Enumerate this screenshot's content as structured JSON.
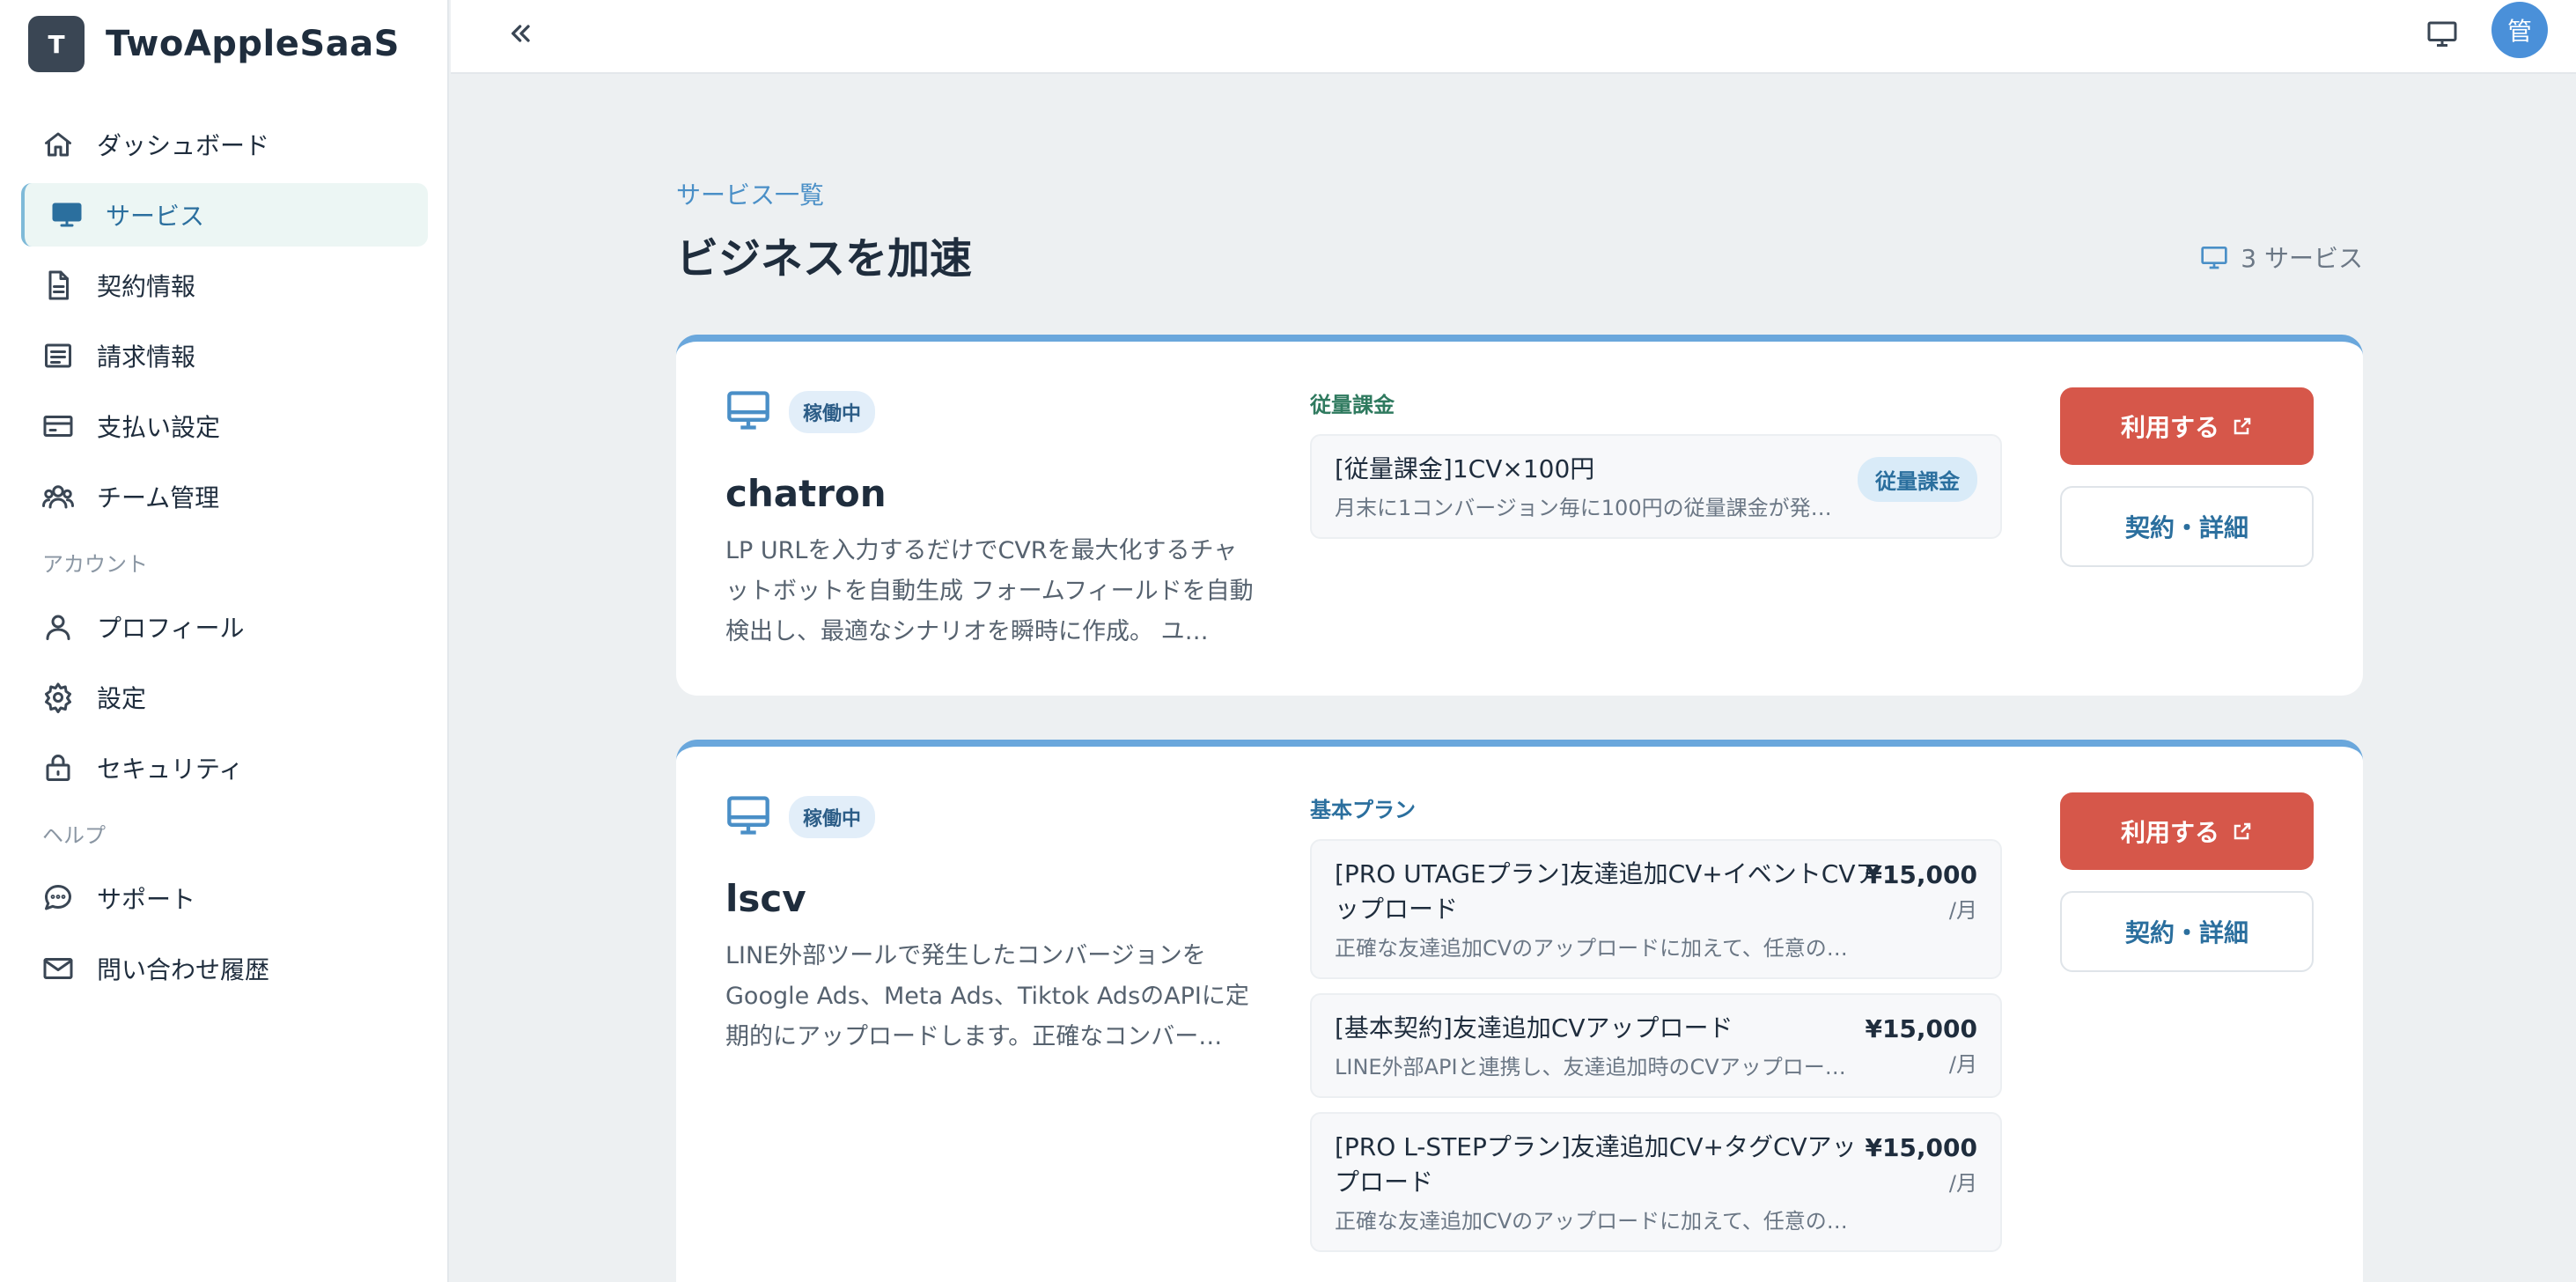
{
  "brand": {
    "logo_letter": "T",
    "name": "TwoAppleSaaS"
  },
  "sidebar": {
    "items": [
      {
        "label": "ダッシュボード",
        "icon": "home-icon"
      },
      {
        "label": "サービス",
        "icon": "monitor-icon",
        "active": true
      },
      {
        "label": "契約情報",
        "icon": "document-icon"
      },
      {
        "label": "請求情報",
        "icon": "invoice-icon"
      },
      {
        "label": "支払い設定",
        "icon": "credit-card-icon"
      },
      {
        "label": "チーム管理",
        "icon": "team-icon"
      }
    ],
    "account_section": "アカウント",
    "account_items": [
      {
        "label": "プロフィール",
        "icon": "user-icon"
      },
      {
        "label": "設定",
        "icon": "gear-icon"
      },
      {
        "label": "セキュリティ",
        "icon": "lock-icon"
      }
    ],
    "help_section": "ヘルプ",
    "help_items": [
      {
        "label": "サポート",
        "icon": "chat-icon"
      },
      {
        "label": "問い合わせ履歴",
        "icon": "mail-icon"
      }
    ]
  },
  "topbar": {
    "avatar_initial": "管"
  },
  "main": {
    "breadcrumb": "サービス一覧",
    "title": "ビジネスを加速",
    "service_count": "3 サービス"
  },
  "services": [
    {
      "status": "稼働中",
      "name": "chatron",
      "description": "LP URLを入力するだけでCVRを最大化するチャットボットを自動生成 フォームフィールドを自動検出し、最適なシナリオを瞬時に作成。 ユ…",
      "plan_heading": "従量課金",
      "plans": [
        {
          "title": "[従量課金]1CV×100円",
          "sub": "月末に1コンバージョン毎に100円の従量課金が発…",
          "tag": "従量課金"
        }
      ],
      "use_label": "利用する",
      "detail_label": "契約・詳細"
    },
    {
      "status": "稼働中",
      "name": "lscv",
      "description": "LINE外部ツールで発生したコンバージョンをGoogle Ads、Meta Ads、Tiktok AdsのAPIに定期的にアップロードします。正確なコンバー…",
      "plan_heading": "基本プラン",
      "plans": [
        {
          "title": "[PRO UTAGEプラン]友達追加CV+イベントCVアップロード",
          "sub": "正確な友達追加CVのアップロードに加えて、任意の…",
          "price": "¥15,000",
          "unit": "/月"
        },
        {
          "title": "[基本契約]友達追加CVアップロード",
          "sub": "LINE外部APIと連携し、友達追加時のCVアップロード…",
          "price": "¥15,000",
          "unit": "/月"
        },
        {
          "title": "[PRO L-STEPプラン]友達追加CV+タグCVアップロード",
          "sub": "正確な友達追加CVのアップロードに加えて、任意の…",
          "price": "¥15,000",
          "unit": "/月"
        }
      ],
      "use_label": "利用する",
      "detail_label": "契約・詳細"
    }
  ]
}
